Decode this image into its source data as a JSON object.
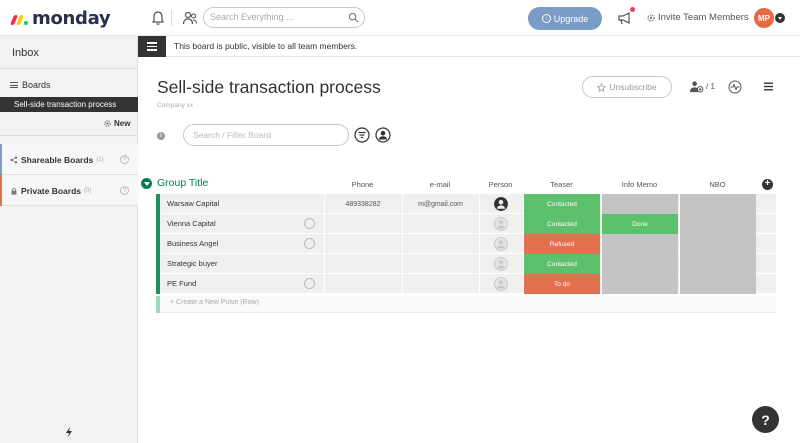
{
  "brand": {
    "name": "monday"
  },
  "header": {
    "search_placeholder": "Search Everything ...",
    "upgrade_label": "Upgrade",
    "invite_label": "Invite Team Members",
    "avatar_initials": "MP"
  },
  "sidebar": {
    "inbox_label": "Inbox",
    "boards_label": "Boards",
    "active_board": "Sell-side transaction process",
    "new_label": "New",
    "shareable_label": "Shareable Boards",
    "shareable_count": "(1)",
    "private_label": "Private Boards",
    "private_count": "(0)"
  },
  "notice": {
    "text": "This board is public, visible to all team members."
  },
  "board": {
    "title": "Sell-side transaction process",
    "subtitle": "Company xx",
    "unsubscribe_label": "Unsubscribe",
    "members_count": "/ 1",
    "filter_placeholder": "Search / Filter Board"
  },
  "table": {
    "group_title": "Group Title",
    "columns": {
      "phone": "Phone",
      "email": "e-mail",
      "person": "Person",
      "teaser": "Teaser",
      "info_memo": "Info Memo",
      "nbo": "NBO"
    },
    "rows": [
      {
        "name": "Warsaw Capital",
        "phone": "489338282",
        "email": "m@gmail.com",
        "teaser": "Contacted",
        "info_memo": "",
        "nbo": ""
      },
      {
        "name": "Vienna Capital",
        "phone": "",
        "email": "",
        "teaser": "Contacted",
        "info_memo": "Done",
        "nbo": ""
      },
      {
        "name": "Business Angel",
        "phone": "",
        "email": "",
        "teaser": "Refused",
        "info_memo": "",
        "nbo": ""
      },
      {
        "name": "Strategic buyer",
        "phone": "",
        "email": "",
        "teaser": "Contacted",
        "info_memo": "",
        "nbo": ""
      },
      {
        "name": "PE Fund",
        "phone": "",
        "email": "",
        "teaser": "To do",
        "info_memo": "",
        "nbo": ""
      }
    ],
    "new_row_placeholder": "+ Create a New Pulse (Row)"
  },
  "help_label": "?",
  "colors": {
    "status_green": "#5dc06c",
    "status_orange": "#e2714f",
    "status_empty": "#c4c4c4",
    "group_green": "#037f4c",
    "upgrade_blue": "#7b9cc6"
  }
}
